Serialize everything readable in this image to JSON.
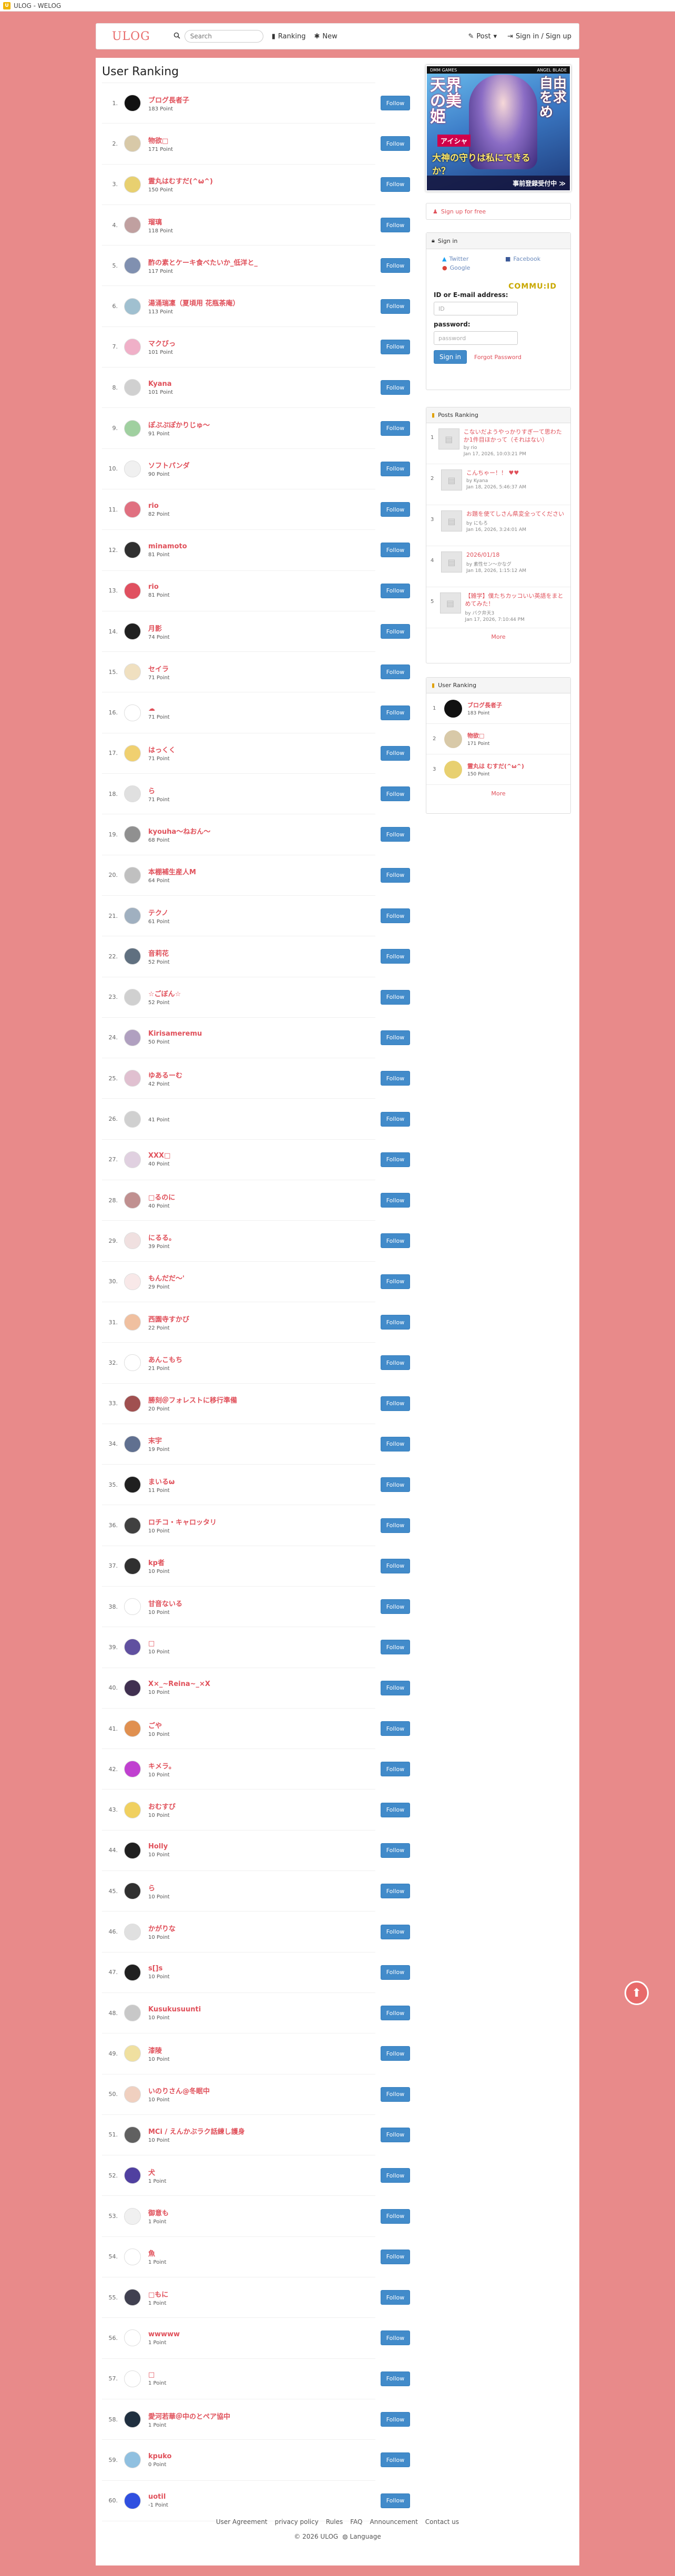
{
  "topbar": {
    "title": "ULOG - WELOG"
  },
  "navbar": {
    "brand": "ULOG",
    "search_placeholder": "Search",
    "ranking_label": "Ranking",
    "new_label": "New",
    "post_label": "Post",
    "signin_label": "Sign in / Sign up"
  },
  "ranking": {
    "title": "User Ranking",
    "follow_label": "Follow",
    "users": [
      {
        "rank": "1.",
        "name": "ブログ長者子",
        "points": "183 Point",
        "color": "#111111"
      },
      {
        "rank": "2.",
        "name": "物欲□",
        "points": "171 Point",
        "color": "#d8c9a8"
      },
      {
        "rank": "3.",
        "name": "霊丸はむすだ(^ω^)",
        "points": "150 Point",
        "color": "#e8d070"
      },
      {
        "rank": "4.",
        "name": "瑠璃",
        "points": "118 Point",
        "color": "#c0a0a0"
      },
      {
        "rank": "5.",
        "name": "酢の素とケーキ食べたいか_低洋と_",
        "points": "117 Point",
        "color": "#8090b0"
      },
      {
        "rank": "6.",
        "name": "湯涌瑞凜（夏頃用 花瓶茶庵）",
        "points": "113 Point",
        "color": "#a0c0d0"
      },
      {
        "rank": "7.",
        "name": "マクびっ",
        "points": "101 Point",
        "color": "#f0b0c8"
      },
      {
        "rank": "8.",
        "name": "Kyana",
        "points": "101 Point",
        "color": "#d0d0d0"
      },
      {
        "rank": "9.",
        "name": "ぽぷぷぽかりじゅ～",
        "points": "91 Point",
        "color": "#a0d0a0"
      },
      {
        "rank": "10.",
        "name": "ソフトパンダ",
        "points": "90 Point",
        "color": "#f0f0f0"
      },
      {
        "rank": "11.",
        "name": "rio",
        "points": "82 Point",
        "color": "#e07080"
      },
      {
        "rank": "12.",
        "name": "minamoto",
        "points": "81 Point",
        "color": "#303030"
      },
      {
        "rank": "13.",
        "name": "rio",
        "points": "81 Point",
        "color": "#e05060"
      },
      {
        "rank": "14.",
        "name": "月影",
        "points": "74 Point",
        "color": "#202020"
      },
      {
        "rank": "15.",
        "name": "セイラ",
        "points": "71 Point",
        "color": "#f0e0c0"
      },
      {
        "rank": "16.",
        "name": "☁",
        "points": "71 Point",
        "color": "#ffffff"
      },
      {
        "rank": "17.",
        "name": "はっくく",
        "points": "71 Point",
        "color": "#f0d070"
      },
      {
        "rank": "18.",
        "name": "ら",
        "points": "71 Point",
        "color": "#e0e0e0"
      },
      {
        "rank": "19.",
        "name": "kyouha～ねおん～",
        "points": "68 Point",
        "color": "#909090"
      },
      {
        "rank": "20.",
        "name": "本棚補生産人M",
        "points": "64 Point",
        "color": "#c0c0c0"
      },
      {
        "rank": "21.",
        "name": "テクノ",
        "points": "61 Point",
        "color": "#a0b0c0"
      },
      {
        "rank": "22.",
        "name": "音莉花",
        "points": "52 Point",
        "color": "#607080"
      },
      {
        "rank": "23.",
        "name": "☆ごぼん☆",
        "points": "52 Point",
        "color": "#d0d0d0"
      },
      {
        "rank": "24.",
        "name": "Kirisameremu",
        "points": "50 Point",
        "color": "#b0a0c0"
      },
      {
        "rank": "25.",
        "name": "ゆあるーむ",
        "points": "42 Point",
        "color": "#e0c0d0"
      },
      {
        "rank": "26.",
        "name": "",
        "points": "41 Point",
        "color": "#d0d0d0"
      },
      {
        "rank": "27.",
        "name": "XXX□",
        "points": "40 Point",
        "color": "#e0d0e0"
      },
      {
        "rank": "28.",
        "name": "□るのに",
        "points": "40 Point",
        "color": "#c09090"
      },
      {
        "rank": "29.",
        "name": "にるる。",
        "points": "39 Point",
        "color": "#f0e0e0"
      },
      {
        "rank": "30.",
        "name": "もんだだ～'",
        "points": "29 Point",
        "color": "#f8e8e8"
      },
      {
        "rank": "31.",
        "name": "西園寺すかび",
        "points": "22 Point",
        "color": "#f0c0a0"
      },
      {
        "rank": "32.",
        "name": "あんこもち",
        "points": "21 Point",
        "color": "#ffffff"
      },
      {
        "rank": "33.",
        "name": "勝刻＠フォレストに移行準備",
        "points": "20 Point",
        "color": "#a05050"
      },
      {
        "rank": "34.",
        "name": "末宇",
        "points": "19 Point",
        "color": "#607090"
      },
      {
        "rank": "35.",
        "name": "まいるω",
        "points": "11 Point",
        "color": "#202020"
      },
      {
        "rank": "36.",
        "name": "ロチコ・キャロッタリ",
        "points": "10 Point",
        "color": "#404040"
      },
      {
        "rank": "37.",
        "name": "kp者",
        "points": "10 Point",
        "color": "#303030"
      },
      {
        "rank": "38.",
        "name": "甘音ないる",
        "points": "10 Point",
        "color": "#ffffff"
      },
      {
        "rank": "39.",
        "name": "□",
        "points": "10 Point",
        "color": "#6050a0"
      },
      {
        "rank": "40.",
        "name": "X×_~Reina~_×X",
        "points": "10 Point",
        "color": "#403050"
      },
      {
        "rank": "41.",
        "name": "ごや",
        "points": "10 Point",
        "color": "#e09050"
      },
      {
        "rank": "42.",
        "name": "キメラ。",
        "points": "10 Point",
        "color": "#c040d0"
      },
      {
        "rank": "43.",
        "name": "おむすび",
        "points": "10 Point",
        "color": "#f0d060"
      },
      {
        "rank": "44.",
        "name": "Holly",
        "points": "10 Point",
        "color": "#202020"
      },
      {
        "rank": "45.",
        "name": "ら",
        "points": "10 Point",
        "color": "#303030"
      },
      {
        "rank": "46.",
        "name": "かがりな",
        "points": "10 Point",
        "color": "#e0e0e0"
      },
      {
        "rank": "47.",
        "name": "s[]s",
        "points": "10 Point",
        "color": "#202020"
      },
      {
        "rank": "48.",
        "name": "Kusukusuunti",
        "points": "10 Point",
        "color": "#c8c8c8"
      },
      {
        "rank": "49.",
        "name": "漆陵",
        "points": "10 Point",
        "color": "#f0e0a0"
      },
      {
        "rank": "50.",
        "name": "いのりさん@冬眠中",
        "points": "10 Point",
        "color": "#f0d0c0"
      },
      {
        "rank": "51.",
        "name": "MCi / えんかぶラク話練し護身",
        "points": "10 Point",
        "color": "#606060"
      },
      {
        "rank": "52.",
        "name": "犬",
        "points": "1 Point",
        "color": "#5040a0"
      },
      {
        "rank": "53.",
        "name": "御意も",
        "points": "1 Point",
        "color": "#f0f0f0"
      },
      {
        "rank": "54.",
        "name": "魚",
        "points": "1 Point",
        "color": "#ffffff"
      },
      {
        "rank": "55.",
        "name": "□もに",
        "points": "1 Point",
        "color": "#404050"
      },
      {
        "rank": "56.",
        "name": "wwwww",
        "points": "1 Point",
        "color": "#ffffff"
      },
      {
        "rank": "57.",
        "name": "□",
        "points": "1 Point",
        "color": "#ffffff"
      },
      {
        "rank": "58.",
        "name": "愛河若華＠中のとペア協中",
        "points": "1 Point",
        "color": "#203040"
      },
      {
        "rank": "59.",
        "name": "kpuko",
        "points": "0 Point",
        "color": "#90c0e0"
      },
      {
        "rank": "60.",
        "name": "uotil",
        "points": "-1 Point",
        "color": "#3050e0"
      }
    ]
  },
  "ad": {
    "top_left": "DMM GAMES",
    "top_right": "ANGEL BLADE",
    "title": "天界の美姫",
    "right_text": "自由を求め",
    "tag": "アイシャ",
    "sub": "大神の守りは私にできるか？",
    "bottom": "事前登録受付中 ≫"
  },
  "sidebar": {
    "signup_label": "Sign up for free",
    "signin_title": "Sign in",
    "social": [
      "Twitter",
      "Facebook",
      "Google"
    ],
    "commu": "COMMU:ID",
    "id_label": "ID or E-mail address:",
    "id_placeholder": "ID",
    "password_label": "password:",
    "password_placeholder": "password",
    "signin_button": "Sign in",
    "forgot": "Forgot Password",
    "posts_title": "Posts Ranking",
    "posts": [
      {
        "num": "1",
        "title": "こないだようやっかりすぎ一て思わたか1件目ほかって（それはない）",
        "by": "by rio",
        "date": "Jan 17, 2026, 10:03:21 PM"
      },
      {
        "num": "2",
        "title": "こんちゃー！！ ♥♥",
        "by": "by Kyana",
        "date": "Jan 18, 2026, 5:46:37 AM"
      },
      {
        "num": "3",
        "title": "お題を使てしさん県変全ってください",
        "by": "by にもろ",
        "date": "Jan 16, 2026, 3:24:01 AM"
      },
      {
        "num": "4",
        "title": "2026/01/18",
        "by": "by 素性セン〜かなグ",
        "date": "Jan 18, 2026, 1:15:12 AM"
      },
      {
        "num": "5",
        "title": "【雑学】僕たちカッコいい英語をまとめてみた！",
        "by": "by バク弁天3",
        "date": "Jan 17, 2026, 7:10:44 PM"
      }
    ],
    "posts_more": "More",
    "ur_title": "User Ranking",
    "ur": [
      {
        "num": "1",
        "name": "ブログ長者子",
        "points": "183 Point"
      },
      {
        "num": "2",
        "name": "物欲□",
        "points": "171 Point"
      },
      {
        "num": "3",
        "name": "霊丸は むすだ(^ω^)",
        "points": "150 Point"
      }
    ],
    "ur_more": "More"
  },
  "footer": {
    "links": [
      "User Agreement",
      "privacy policy",
      "Rules",
      "FAQ",
      "Announcement",
      "Contact us"
    ],
    "copyright": "© 2026 ULOG",
    "language": "Language"
  },
  "colors": {
    "background": "#e88a8a",
    "accent": "#e0505a",
    "button": "#428bca"
  }
}
